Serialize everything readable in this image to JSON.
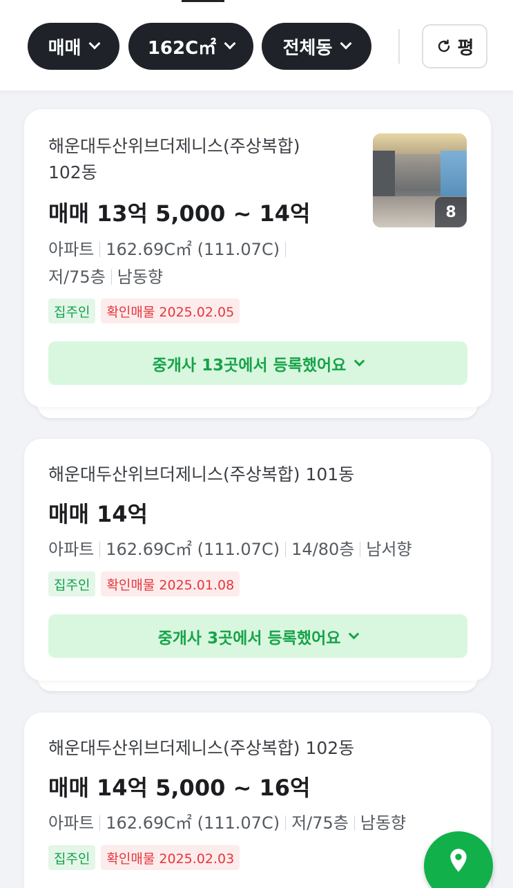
{
  "filters": {
    "trade_type": "매매",
    "area": "162C㎡",
    "building": "전체동",
    "unit_toggle": "평"
  },
  "listings": [
    {
      "title": "해운대두산위브더제니스(주상복합) 102동",
      "title_line1": "해운대두산위브더제니스(주상복합)",
      "title_line2": "102동",
      "price": "매매 13억 5,000 ~ 14억",
      "type": "아파트",
      "area": "162.69C㎡ (111.07C)",
      "floor": "저/75층",
      "direction": "남동향",
      "owner_tag": "집주인",
      "verified_tag": "확인매물 2025.02.05",
      "agent_text": "중개사 13곳에서 등록했어요",
      "photo_count": "8"
    },
    {
      "title": "해운대두산위브더제니스(주상복합) 101동",
      "price": "매매 14억",
      "type": "아파트",
      "area": "162.69C㎡ (111.07C)",
      "floor": "14/80층",
      "direction": "남서향",
      "owner_tag": "집주인",
      "verified_tag": "확인매물 2025.01.08",
      "agent_text": "중개사 3곳에서 등록했어요"
    },
    {
      "title": "해운대두산위브더제니스(주상복합) 102동",
      "price": "매매 14억 5,000 ~ 16억",
      "type": "아파트",
      "area": "162.69C㎡ (111.07C)",
      "floor": "저/75층",
      "direction": "남동향",
      "owner_tag": "집주인",
      "verified_tag": "확인매물 2025.02.03"
    }
  ],
  "colors": {
    "chip_bg": "#1f2329",
    "accent_green": "#16a349",
    "owner_tag_bg": "#e3f6e8",
    "verified_tag_text": "#e5353b"
  },
  "icons": {
    "refresh": "refresh-icon",
    "chevron": "chevron-down-icon",
    "map_pin": "map-pin-icon"
  }
}
